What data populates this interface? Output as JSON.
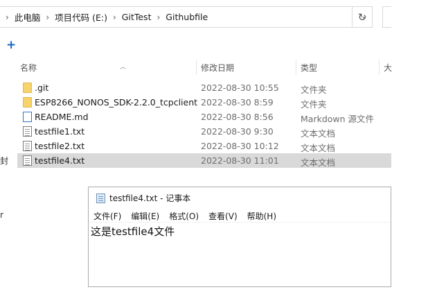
{
  "address_bar": {
    "crumbs": [
      "此电脑",
      "项目代码 (E:)",
      "GitTest",
      "Githubfile"
    ]
  },
  "columns": {
    "name": "名称",
    "date": "修改日期",
    "type": "类型",
    "size_partial": "大"
  },
  "files": [
    {
      "name": ".git",
      "date": "2022-08-30 10:55",
      "type": "文件夹",
      "icon": "folder-icon"
    },
    {
      "name": "ESP8266_NONOS_SDK-2.2.0_tcpclient",
      "date": "2022-08-30 8:59",
      "type": "文件夹",
      "icon": "folder-icon"
    },
    {
      "name": "README.md",
      "date": "2022-08-30 8:56",
      "type": "Markdown 源文件",
      "icon": "markdown-file-icon"
    },
    {
      "name": "testfile1.txt",
      "date": "2022-08-30 9:30",
      "type": "文本文档",
      "icon": "text-file-icon"
    },
    {
      "name": "testfile2.txt",
      "date": "2022-08-30 10:12",
      "type": "文本文档",
      "icon": "text-file-icon"
    },
    {
      "name": "testfile4.txt",
      "date": "2022-08-30 11:01",
      "type": "文本文档",
      "icon": "text-file-icon",
      "selected": true
    }
  ],
  "left_clip_chars": [
    "封",
    "r"
  ],
  "notepad": {
    "title": "testfile4.txt - 记事本",
    "menu": [
      "文件(F)",
      "编辑(E)",
      "格式(O)",
      "查看(V)",
      "帮助(H)"
    ],
    "content": "这是testfile4文件"
  },
  "colors": {
    "selection": "#d9d9d9",
    "accent": "#1565c0",
    "folder": "#f6d36b"
  }
}
